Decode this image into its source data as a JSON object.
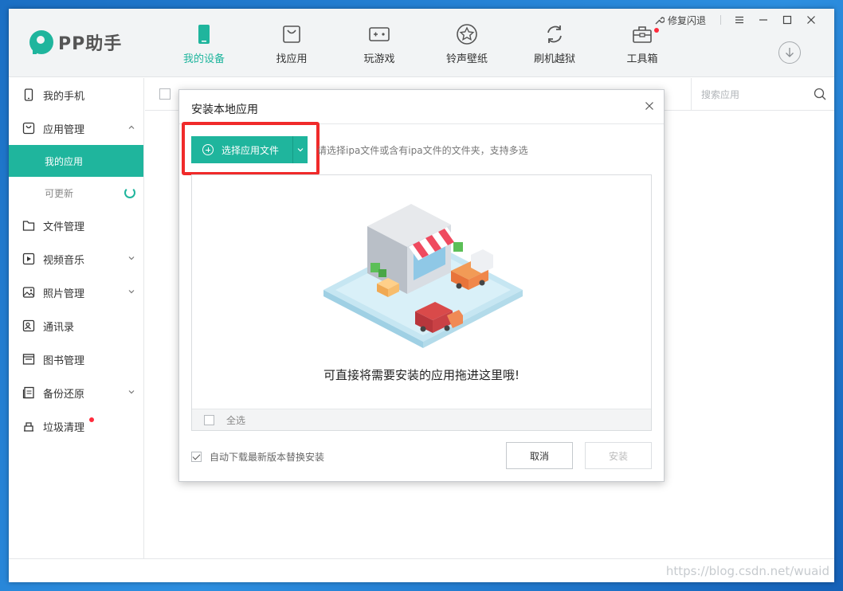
{
  "app": {
    "logo_text": "PP助手"
  },
  "nav": [
    {
      "label": "我的设备",
      "icon": "phone-icon",
      "active": true
    },
    {
      "label": "找应用",
      "icon": "app-bag-icon",
      "active": false
    },
    {
      "label": "玩游戏",
      "icon": "gamepad-icon",
      "active": false
    },
    {
      "label": "铃声壁纸",
      "icon": "star-icon",
      "active": false
    },
    {
      "label": "刷机越狱",
      "icon": "refresh-icon",
      "active": false
    },
    {
      "label": "工具箱",
      "icon": "toolbox-icon",
      "active": false
    }
  ],
  "top_right": {
    "fix_label": "修复闪退"
  },
  "sidebar": {
    "items": [
      {
        "label": "我的手机"
      },
      {
        "label": "应用管理"
      },
      {
        "label": "文件管理"
      },
      {
        "label": "视频音乐"
      },
      {
        "label": "照片管理"
      },
      {
        "label": "通讯录"
      },
      {
        "label": "图书管理"
      },
      {
        "label": "备份还原"
      },
      {
        "label": "垃圾清理"
      }
    ],
    "sub_items": [
      {
        "label": "我的应用"
      },
      {
        "label": "可更新"
      }
    ]
  },
  "toolbar": {
    "search_placeholder": "搜索应用"
  },
  "dialog": {
    "title": "安装本地应用",
    "pick_button_label": "选择应用文件",
    "hint": "请选择ipa文件或含有ipa文件的文件夹，支持多选",
    "drop_text": "可直接将需要安装的应用拖进这里哦!",
    "select_all_label": "全选",
    "auto_download_label": "自动下载最新版本替换安装",
    "cancel_label": "取消",
    "install_label": "安装"
  },
  "watermark": "https://blog.csdn.net/wuaid",
  "colors": {
    "accent": "#1fb59d",
    "highlight": "#f02a2a",
    "badge": "#ff2b3c"
  }
}
